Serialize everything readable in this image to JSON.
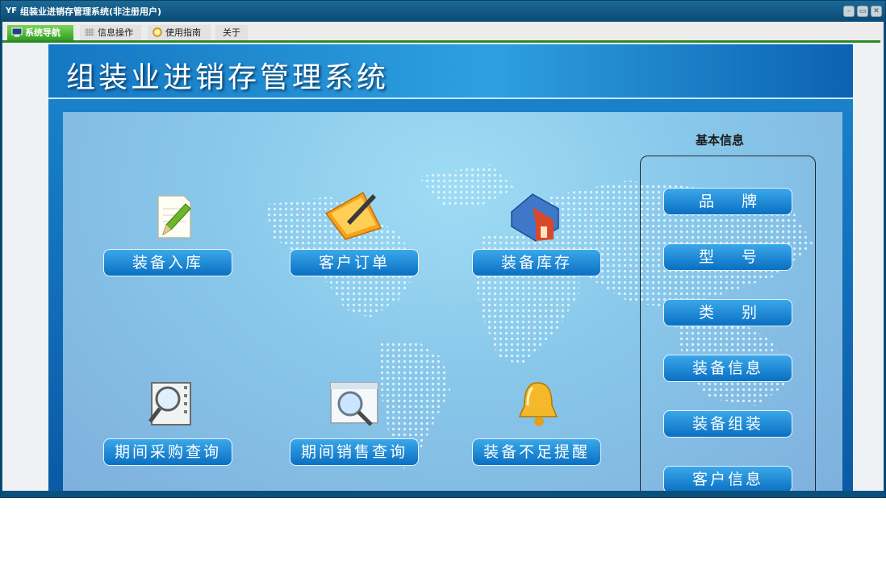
{
  "window": {
    "title": "组装业进销存管理系统(非注册用户)",
    "app_icon": "YF",
    "controls": {
      "minimize": "–",
      "restore": "▭",
      "close": "✕"
    }
  },
  "tabs": [
    {
      "label": "系统导航",
      "icon": "monitor-icon",
      "active": true
    },
    {
      "label": "信息操作",
      "icon": "grid-icon",
      "active": false
    },
    {
      "label": "使用指南",
      "icon": "help-clock-icon",
      "active": false
    },
    {
      "label": "关于",
      "icon": "",
      "active": false
    }
  ],
  "banner": {
    "title": "组装业进销存管理系统"
  },
  "main_menu": [
    {
      "label": "装备入库",
      "icon": "notepad-pencil-icon"
    },
    {
      "label": "客户订单",
      "icon": "folder-pen-icon"
    },
    {
      "label": "装备库存",
      "icon": "warehouse-house-icon"
    },
    {
      "label": "期间采购查询",
      "icon": "magnifier-film-icon"
    },
    {
      "label": "期间销售查询",
      "icon": "magnifier-window-icon"
    },
    {
      "label": "装备不足提醒",
      "icon": "bell-icon"
    }
  ],
  "side_panel": {
    "title": "基本信息",
    "items": [
      "品牌",
      "型号",
      "类别",
      "装备信息",
      "装备组装",
      "客户信息"
    ]
  },
  "colors": {
    "title_bar": "#0b4a74",
    "tab_active": "#2f9a1f",
    "banner": "#1477c2",
    "button": "#0a6fc2",
    "panel": "#88c7ea"
  }
}
